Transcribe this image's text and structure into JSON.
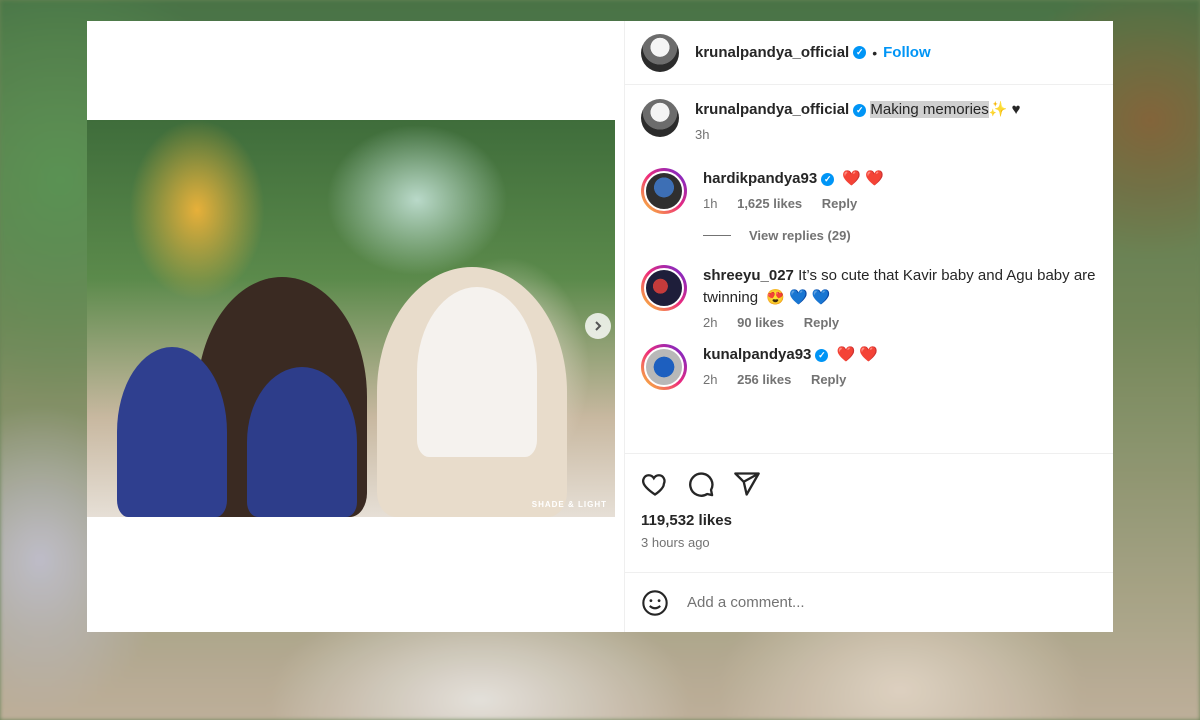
{
  "post": {
    "author": "krunalpandya_official",
    "follow_label": "Follow",
    "separator": "•",
    "caption": {
      "highlighted": "Making memories",
      "suffix": "✨ ♥",
      "time": "3h"
    },
    "watermark": "SHADE & LIGHT"
  },
  "comments": [
    {
      "username": "hardikpandya93",
      "verified": true,
      "text": "❤️ ❤️",
      "time": "1h",
      "likes": "1,625 likes",
      "reply": "Reply",
      "view_replies": "View replies (29)"
    },
    {
      "username": "shreeyu_027",
      "verified": false,
      "text": "It’s so cute that Kavir baby and Agu baby are twinning",
      "emoji": "😍 💙 💙",
      "time": "2h",
      "likes": "90 likes",
      "reply": "Reply"
    },
    {
      "username": "kunalpandya93",
      "verified": true,
      "text": "❤️ ❤️",
      "time": "2h",
      "likes": "256 likes",
      "reply": "Reply"
    }
  ],
  "stats": {
    "likes": "119,532 likes",
    "posted": "3 hours ago"
  },
  "composer": {
    "placeholder": "Add a comment..."
  },
  "icons": {
    "like": "heart-icon",
    "comment": "comment-icon",
    "share": "share-icon",
    "emoji": "emoji-icon",
    "verified": "verified-badge-icon",
    "next": "chevron-right-icon"
  },
  "colors": {
    "accent": "#0095f6",
    "heart": "#e0245e",
    "muted": "#737373"
  }
}
